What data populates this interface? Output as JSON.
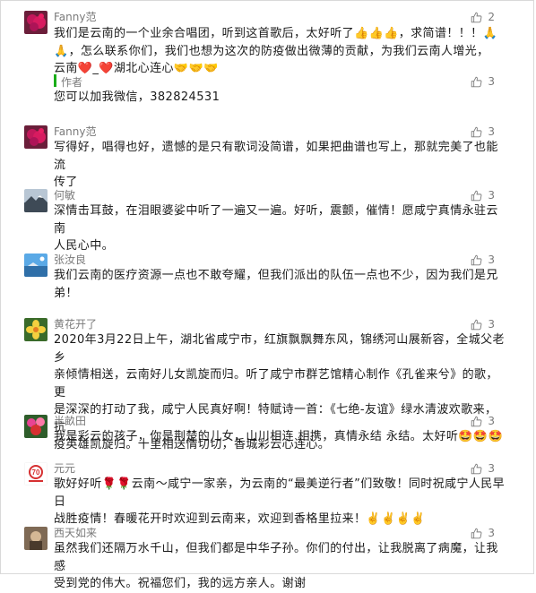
{
  "comments": [
    {
      "name": "Fanny范",
      "likes": "2",
      "lines": [
        "我们是云南的一个业余合唱团，听到这首歌后，太好听了👍👍👍，求简谱！！！🙏",
        "🙏，怎么联系你们，我们也想为这次的防疫做出微薄的贡献，为我们云南人增光，",
        "云南❤️_❤️湖北心连心🤝🤝🤝"
      ],
      "reply": {
        "name": "作者",
        "likes": "3",
        "text": "您可以加我微信，382824531"
      }
    },
    {
      "name": "Fanny范",
      "likes": "3",
      "lines": [
        "写得好，唱得也好，遗憾的是只有歌词没简谱，如果把曲谱也写上，那就完美了也能流",
        "传了"
      ]
    },
    {
      "name": "何敏",
      "likes": "3",
      "lines": [
        "深情击耳鼓，在泪眼婆娑中听了一遍又一遍。好听，震颤，催情！愿咸宁真情永驻云南",
        "人民心中。"
      ]
    },
    {
      "name": "张汝良",
      "likes": "3",
      "lines": [
        "我们云南的医疗资源一点也不敢夸耀，但我们派出的队伍一点也不少，因为我们是兄",
        "弟！"
      ]
    },
    {
      "name": "黄花开了",
      "likes": "3",
      "lines": [
        "2020年3月22日上午，湖北省咸宁市，红旗飘飘舞东风，锦绣河山展新容，全城父老乡",
        "亲倾情相送，云南好儿女凯旋而归。听了咸宁市群艺馆精心制作《孔雀来兮》的歌，更",
        "是深深的打动了我，咸宁人民真好啊！特赋诗一首：《七绝-友谊》绿水清波欢歌来，抗",
        "疫英雄凯旋归。十里相送情切切，香城彩云心连心。"
      ]
    },
    {
      "name": "半畝田",
      "likes": "3",
      "lines": [
        "我是彩云的孩子，你是荆楚的儿女，山川相连 相携，真情永结 永结。太好听🤩🤩🤩"
      ]
    },
    {
      "name": "元元",
      "likes": "3",
      "lines": [
        "歌好好听🌹🌹云南～咸宁一家亲，为云南的“最美逆行者”们致敬！同时祝咸宁人民早日",
        "战胜疫情！春暖花开时欢迎到云南来，欢迎到香格里拉来！✌️✌️✌️✌️"
      ]
    },
    {
      "name": "西天如来",
      "likes": "3",
      "lines": [
        "虽然我们还隔万水千山，但我们都是中华子孙。你们的付出，让我脱离了病魔，让我感",
        "受到党的伟大。祝福您们，我的远方亲人。谢谢"
      ]
    }
  ],
  "colors": {
    "name": "#7a7a7a",
    "text": "#1a1a1a",
    "reply_bar": "#1aad19",
    "border": "#d9d9d9"
  },
  "icons": {
    "like": "thumbs-up-outline-icon"
  }
}
